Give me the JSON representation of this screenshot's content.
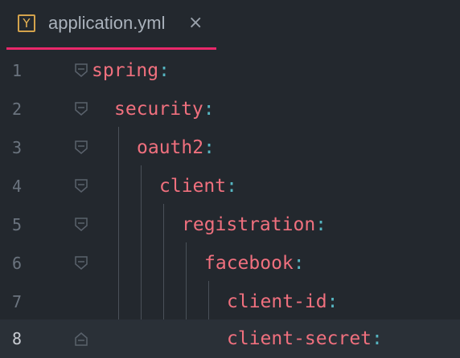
{
  "tab": {
    "icon_letter": "Y",
    "title": "application.yml",
    "close_symbol": "×"
  },
  "lines": [
    {
      "number": "1",
      "key": "spring",
      "colon": ":"
    },
    {
      "number": "2",
      "key": "security",
      "colon": ":"
    },
    {
      "number": "3",
      "key": "oauth2",
      "colon": ":"
    },
    {
      "number": "4",
      "key": "client",
      "colon": ":"
    },
    {
      "number": "5",
      "key": "registration",
      "colon": ":"
    },
    {
      "number": "6",
      "key": "facebook",
      "colon": ":"
    },
    {
      "number": "7",
      "key": "client-id",
      "colon": ":"
    },
    {
      "number": "8",
      "key": "client-secret",
      "colon": ":"
    }
  ],
  "colors": {
    "background": "#23282e",
    "key": "#f0707e",
    "colon": "#56b6c2",
    "active_tab_underline": "#e9286a",
    "yaml_icon": "#e8b454"
  }
}
